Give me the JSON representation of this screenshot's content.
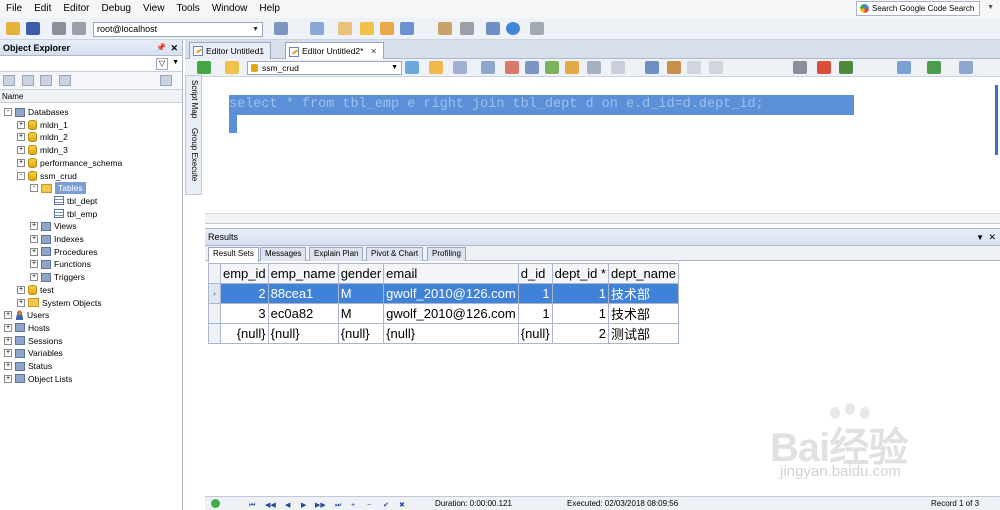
{
  "menu": {
    "items": [
      "File",
      "Edit",
      "Editor",
      "Debug",
      "View",
      "Tools",
      "Window",
      "Help"
    ],
    "search_placeholder": "Search Google Code Search"
  },
  "toolbar": {
    "connection": "root@localhost",
    "database": "ssm_crud"
  },
  "object_explorer": {
    "title": "Object Explorer",
    "column": "Name",
    "tree": [
      {
        "label": "Databases",
        "level": 0,
        "expand": "-",
        "icon": "databases-icon"
      },
      {
        "label": "mldn_1",
        "level": 1,
        "expand": "+",
        "icon": "database-icon"
      },
      {
        "label": "mldn_2",
        "level": 1,
        "expand": "+",
        "icon": "database-icon"
      },
      {
        "label": "mldn_3",
        "level": 1,
        "expand": "+",
        "icon": "database-icon"
      },
      {
        "label": "performance_schema",
        "level": 1,
        "expand": "+",
        "icon": "database-icon"
      },
      {
        "label": "ssm_crud",
        "level": 1,
        "expand": "-",
        "icon": "database-icon"
      },
      {
        "label": "Tables",
        "level": 2,
        "expand": "-",
        "icon": "folder-icon",
        "selected": true
      },
      {
        "label": "tbl_dept",
        "level": 3,
        "expand": "",
        "icon": "table-icon"
      },
      {
        "label": "tbl_emp",
        "level": 3,
        "expand": "",
        "icon": "table-icon"
      },
      {
        "label": "Views",
        "level": 2,
        "expand": "+",
        "icon": "views-icon"
      },
      {
        "label": "Indexes",
        "level": 2,
        "expand": "+",
        "icon": "indexes-icon"
      },
      {
        "label": "Procedures",
        "level": 2,
        "expand": "+",
        "icon": "procedures-icon"
      },
      {
        "label": "Functions",
        "level": 2,
        "expand": "+",
        "icon": "functions-icon"
      },
      {
        "label": "Triggers",
        "level": 2,
        "expand": "+",
        "icon": "triggers-icon"
      },
      {
        "label": "test",
        "level": 1,
        "expand": "+",
        "icon": "database-icon"
      },
      {
        "label": "System Objects",
        "level": 1,
        "expand": "+",
        "icon": "folder-icon"
      },
      {
        "label": "Users",
        "level": 0,
        "expand": "+",
        "icon": "users-icon"
      },
      {
        "label": "Hosts",
        "level": 0,
        "expand": "+",
        "icon": "hosts-icon"
      },
      {
        "label": "Sessions",
        "level": 0,
        "expand": "+",
        "icon": "sessions-icon"
      },
      {
        "label": "Variables",
        "level": 0,
        "expand": "+",
        "icon": "variables-icon"
      },
      {
        "label": "Status",
        "level": 0,
        "expand": "+",
        "icon": "status-icon"
      },
      {
        "label": "Object Lists",
        "level": 0,
        "expand": "+",
        "icon": "object-lists-icon"
      }
    ]
  },
  "side_tabs": [
    "Script Map",
    "Group Execute"
  ],
  "editor_tabs": [
    {
      "label": "Editor Untitled1",
      "active": false
    },
    {
      "label": "Editor Untitled2*",
      "active": true
    }
  ],
  "editor": {
    "sql": "select * from tbl_emp e right join tbl_dept d on e.d_id=d.dept_id;"
  },
  "results": {
    "title": "Results",
    "tabs": [
      "Result Sets",
      "Messages",
      "Explain Plan",
      "Pivot & Chart",
      "Profiling"
    ],
    "columns": [
      "emp_id",
      "emp_name",
      "gender",
      "email",
      "d_id",
      "dept_id *",
      "dept_name"
    ],
    "rows": [
      [
        "2",
        "88cea1",
        "M",
        "gwolf_2010@126.com",
        "1",
        "1",
        "技术部"
      ],
      [
        "3",
        "ec0a82",
        "M",
        "gwolf_2010@126.com",
        "1",
        "1",
        "技术部"
      ],
      [
        "{null}",
        "{null}",
        "{null}",
        "{null}",
        "{null}",
        "2",
        "测试部"
      ]
    ]
  },
  "status": {
    "duration": "Duration: 0:00:00.121",
    "executed": "Executed: 02/03/2018 08:09:56",
    "record": "Record 1 of 3"
  },
  "watermark": {
    "brand": "Bai经验",
    "url": "jingyan.baidu.com"
  }
}
